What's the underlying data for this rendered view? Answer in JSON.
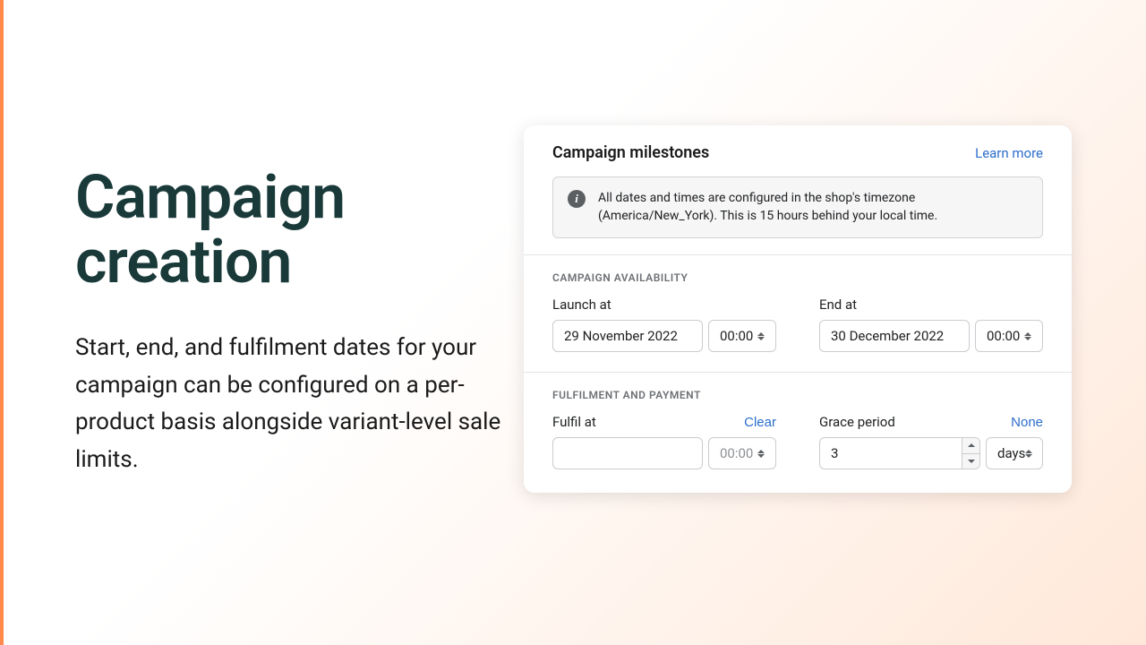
{
  "hero": {
    "title": "Campaign creation",
    "description": "Start, end, and fulfilment dates for your campaign can be configured on a per-product basis alongside variant-level sale limits."
  },
  "card": {
    "title": "Campaign milestones",
    "learn_more": "Learn more",
    "info": "All dates and times are configured in the shop's timezone (America/New_York). This is 15 hours behind your local time.",
    "availability": {
      "section_label": "CAMPAIGN AVAILABILITY",
      "launch": {
        "label": "Launch at",
        "date": "29 November 2022",
        "time": "00:00"
      },
      "end": {
        "label": "End at",
        "date": "30 December 2022",
        "time": "00:00"
      }
    },
    "fulfil": {
      "section_label": "FULFILMENT AND PAYMENT",
      "fulfil_at": {
        "label": "Fulfil at",
        "clear": "Clear",
        "date": "",
        "time": "00:00"
      },
      "grace": {
        "label": "Grace period",
        "none": "None",
        "value": "3",
        "unit": "days"
      }
    }
  }
}
